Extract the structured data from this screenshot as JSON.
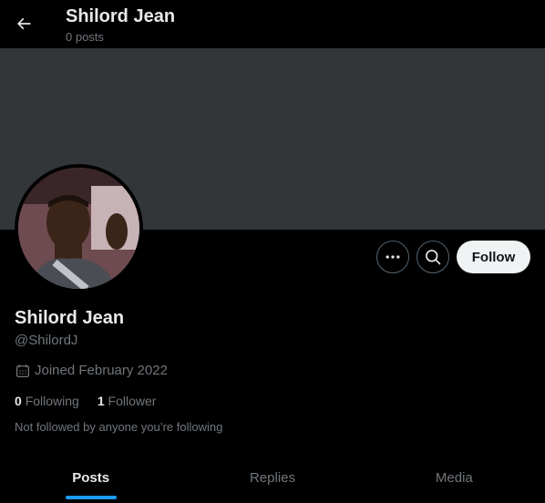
{
  "header": {
    "title": "Shilord Jean",
    "post_count": "0 posts"
  },
  "profile": {
    "display_name": "Shilord Jean",
    "handle": "@ShilordJ",
    "joined": "Joined February 2022",
    "following_count": "0",
    "following_label": "Following",
    "followers_count": "1",
    "followers_label": "Follower",
    "mutuals_note": "Not followed by anyone you’re following"
  },
  "actions": {
    "follow_label": "Follow",
    "more_icon": "more-icon",
    "search_icon": "search-icon"
  },
  "tabs": [
    {
      "label": "Posts",
      "active": true
    },
    {
      "label": "Replies",
      "active": false
    },
    {
      "label": "Media",
      "active": false
    }
  ],
  "colors": {
    "background": "#000000",
    "banner": "#333639",
    "accent": "#1d9bf0",
    "text_primary": "#e7e9ea",
    "text_secondary": "#71767b",
    "follow_button_bg": "#eff3f4"
  }
}
